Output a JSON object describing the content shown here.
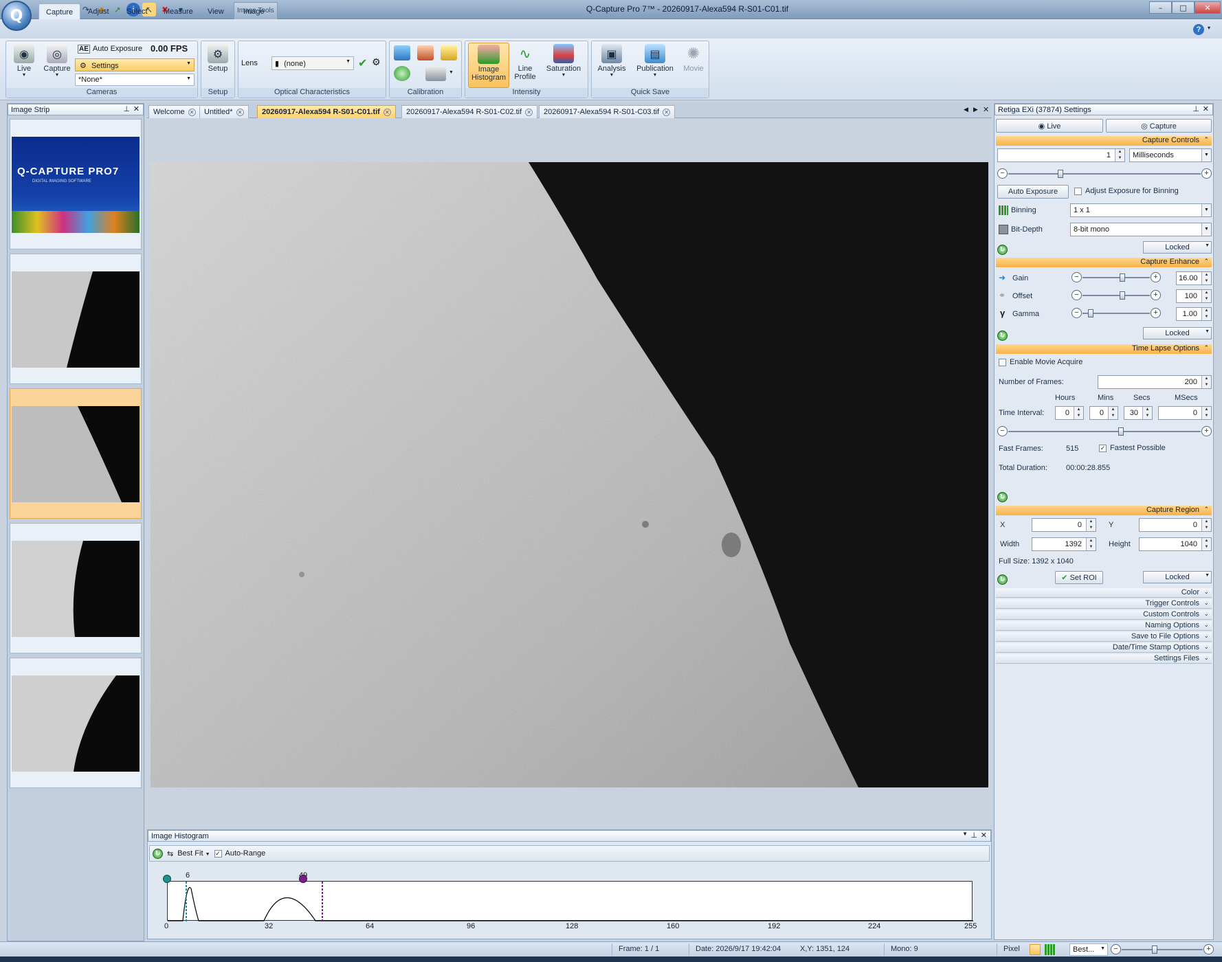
{
  "window": {
    "title": "Q-Capture Pro 7™ - 20260917-Alexa594 R-S01-C01.tif",
    "image_tools": "Image Tools"
  },
  "menu": {
    "tabs": [
      "Capture",
      "Adjust",
      "Select",
      "Measure",
      "View",
      "Image"
    ]
  },
  "ribbon": {
    "cameras": {
      "live": "Live",
      "capture": "Capture",
      "auto_exposure": "Auto Exposure",
      "fps": "0.00 FPS",
      "settings": "Settings",
      "preset": "*None*",
      "label": "Cameras"
    },
    "setup": {
      "button": "Setup",
      "label": "Setup"
    },
    "optical": {
      "lens_label": "Lens",
      "lens_value": "(none)",
      "label": "Optical Characteristics"
    },
    "calibration": {
      "label": "Calibration"
    },
    "intensity": {
      "histogram_line1": "Image",
      "histogram_line2": "Histogram",
      "profile_line1": "Line",
      "profile_line2": "Profile",
      "saturation": "Saturation",
      "label": "Intensity"
    },
    "quicksave": {
      "analysis": "Analysis",
      "publication": "Publication",
      "movie": "Movie",
      "label": "Quick Save"
    }
  },
  "image_strip": {
    "title": "Image Strip",
    "splash_title": "Q-CAPTURE PRO7",
    "splash_sub": "DIGITAL IMAGING SOFTWARE"
  },
  "documents": {
    "tabs": [
      "Welcome",
      "Untitled*",
      "20260917-Alexa594 R-S01-C01.tif",
      "20260917-Alexa594 R-S01-C02.tif",
      "20260917-Alexa594 R-S01-C03.tif"
    ],
    "active_index": 2
  },
  "histogram": {
    "title": "Image Histogram",
    "fit": "Best Fit",
    "auto_range": "Auto-Range",
    "low_marker": "6",
    "high_marker": "49",
    "ticks": [
      "0",
      "32",
      "64",
      "96",
      "128",
      "160",
      "192",
      "224",
      "255"
    ]
  },
  "settings": {
    "title": "Retiga EXi (37874) Settings",
    "live_tab": "Live",
    "capture_tab": "Capture",
    "capture_controls": {
      "header": "Capture Controls",
      "exposure_value": "1",
      "exposure_unit": "Milliseconds",
      "auto_exposure": "Auto Exposure",
      "adjust_binning": "Adjust Exposure for Binning",
      "binning_label": "Binning",
      "binning_value": "1 x 1",
      "bitdepth_label": "Bit-Depth",
      "bitdepth_value": "8-bit mono",
      "locked": "Locked"
    },
    "capture_enhance": {
      "header": "Capture Enhance",
      "gain_label": "Gain",
      "gain_value": "16.00",
      "offset_label": "Offset",
      "offset_value": "100",
      "gamma_label": "Gamma",
      "gamma_value": "1.00",
      "locked": "Locked"
    },
    "time_lapse": {
      "header": "Time Lapse Options",
      "enable_movie": "Enable Movie Acquire",
      "frames_label": "Number of  Frames:",
      "frames_value": "200",
      "hours": "Hours",
      "mins": "Mins",
      "secs": "Secs",
      "msecs": "MSecs",
      "interval_label": "Time Interval:",
      "hours_value": "0",
      "mins_value": "0",
      "secs_value": "30",
      "msecs_value": "0",
      "fast_frames_label": "Fast Frames:",
      "fast_frames_value": "515",
      "fastest_possible": "Fastest Possible",
      "total_duration_label": "Total Duration:",
      "total_duration_value": "00:00:28.855"
    },
    "capture_region": {
      "header": "Capture Region",
      "x_label": "X",
      "x_value": "0",
      "y_label": "Y",
      "y_value": "0",
      "width_label": "Width",
      "width_value": "1392",
      "height_label": "Height",
      "height_value": "1040",
      "full_size": "Full Size: 1392 x 1040",
      "set_roi": "Set ROI",
      "locked": "Locked"
    },
    "collapsed": [
      "Color",
      "Trigger Controls",
      "Custom Controls",
      "Naming Options",
      "Save to File Options",
      "Date/Time Stamp Options",
      "Settings Files"
    ]
  },
  "status": {
    "frame": "Frame: 1 / 1",
    "date": "Date: 2026/9/17 19:42:04",
    "xy": "X,Y: 1351,  124",
    "mono": "Mono:    9",
    "pixel": "Pixel",
    "zoom": "Best..."
  }
}
